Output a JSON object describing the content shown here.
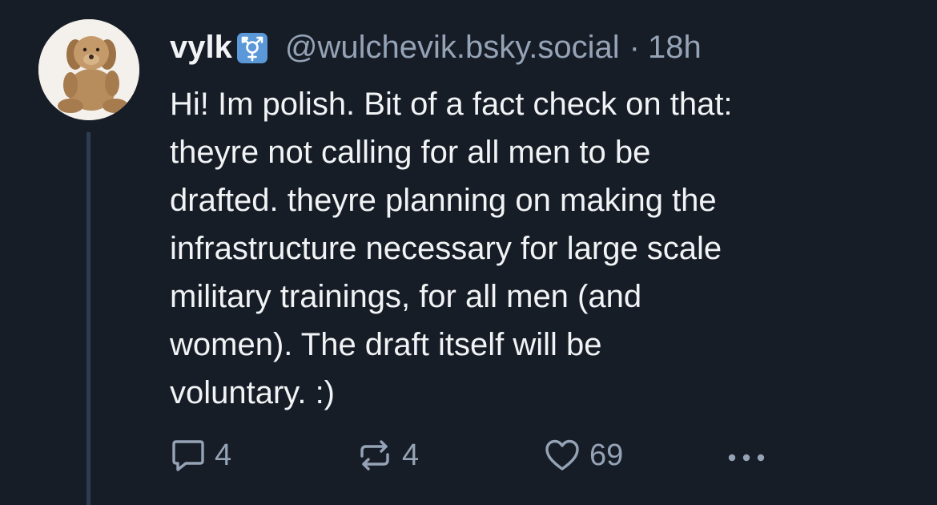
{
  "post": {
    "author": {
      "display_name": "vylk",
      "badge_icon": "transgender-symbol-icon",
      "handle": "@wulchevik.bsky.social",
      "avatar": "teddy-bear-avatar"
    },
    "separator": "·",
    "time_ago": "18h",
    "text": "Hi! Im polish. Bit of a fact check on that:\ntheyre not calling for all men to be\ndrafted. theyre planning on making the\ninfrastructure necessary for large scale\nmilitary trainings, for all men (and\nwomen). The draft itself will be\nvoluntary. :)",
    "actions": {
      "reply": {
        "icon": "reply-icon",
        "count": "4"
      },
      "repost": {
        "icon": "repost-icon",
        "count": "4"
      },
      "like": {
        "icon": "heart-icon",
        "count": "69"
      },
      "more": {
        "icon": "more-options-icon"
      }
    }
  },
  "colors": {
    "background": "#171d27",
    "text_primary": "#f1f3f5",
    "text_secondary": "#95a3b6",
    "thread_line": "#2e3d52",
    "badge_background": "#5a98d8"
  }
}
